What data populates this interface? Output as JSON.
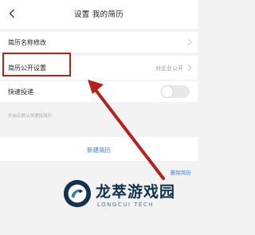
{
  "header": {
    "title": "设置 我的简历"
  },
  "settings": {
    "rename_label": "简历名称修改",
    "public_label": "简历公开设置",
    "public_value": "对企业公开",
    "quick_apply_label": "快速投递",
    "quick_apply_hint": "开启后默认快速投简历",
    "quick_apply_enabled": false
  },
  "actions": {
    "new_resume": "新建简历",
    "delete_resume": "删除简历"
  },
  "watermark": {
    "name": "龙萃游戏园",
    "sub": "LONGCUI TECH"
  },
  "colors": {
    "accent": "#3d7fd8",
    "annotation": "#b5221d",
    "background": "#f3f3f3"
  }
}
